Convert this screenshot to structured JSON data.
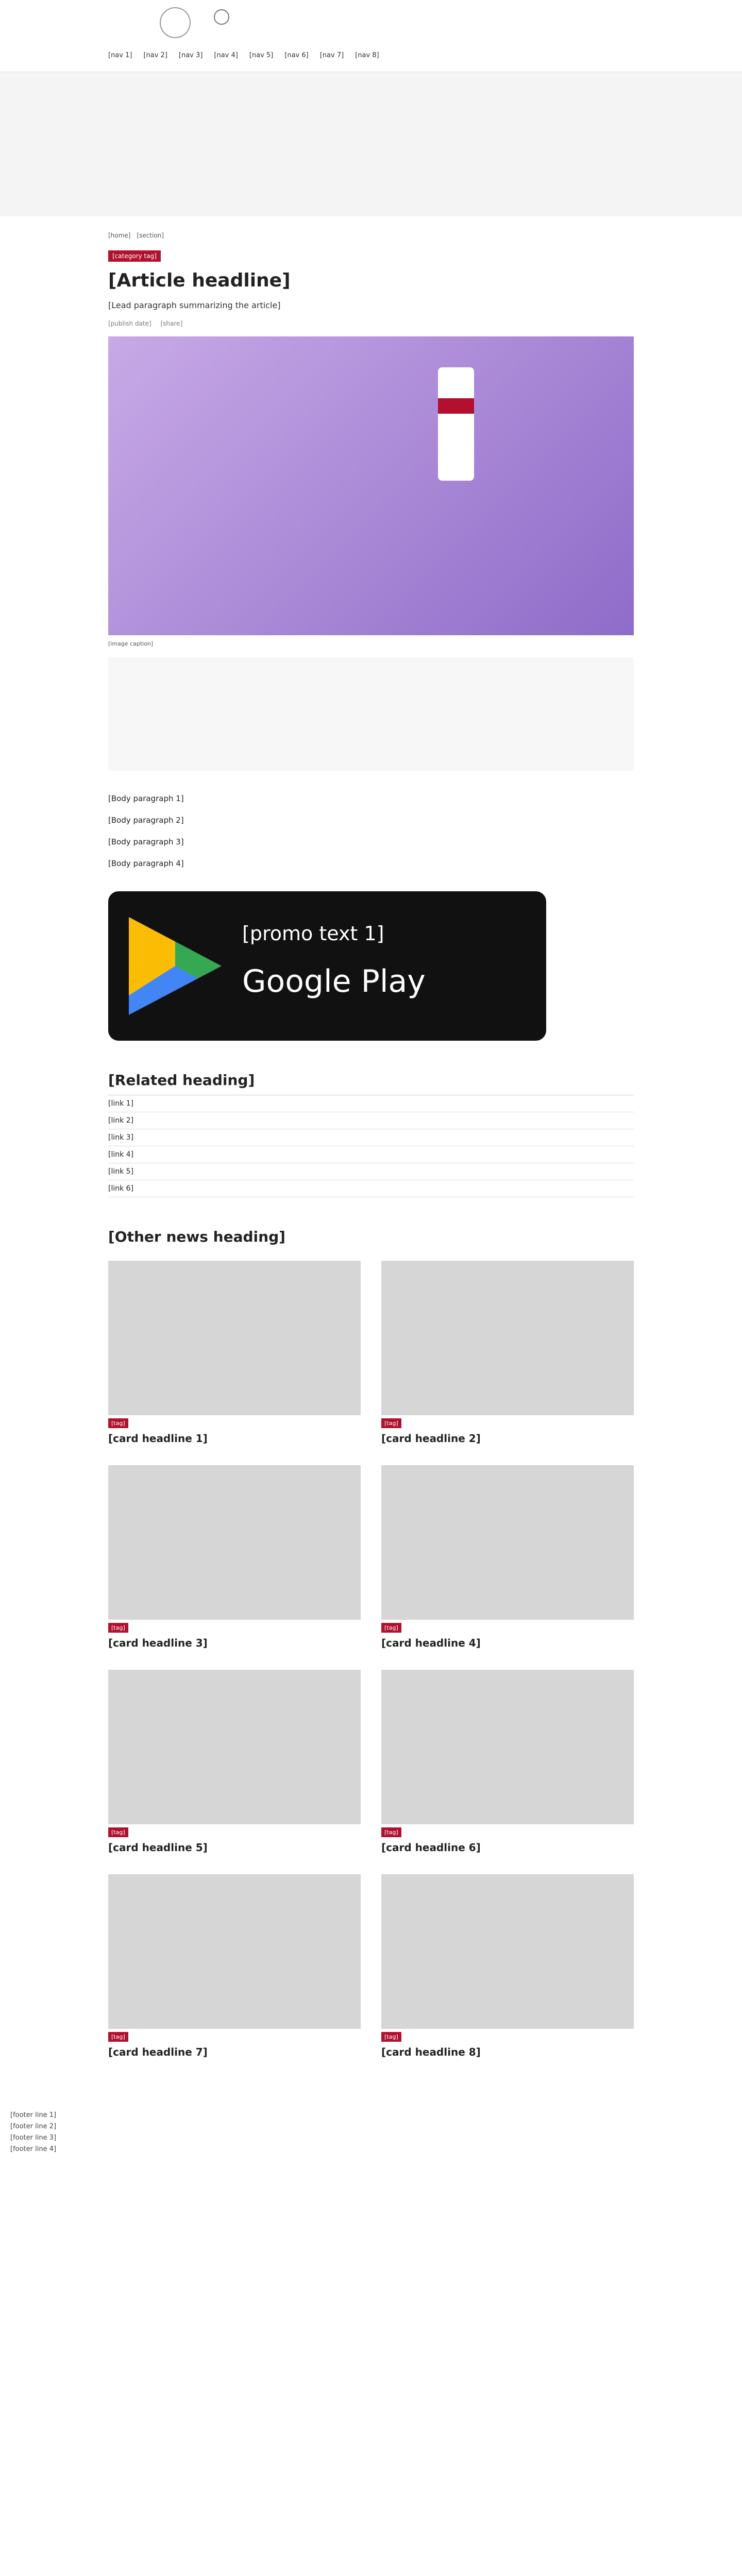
{
  "header": {
    "nav": [
      "[nav 1]",
      "[nav 2]",
      "[nav 3]",
      "[nav 4]",
      "[nav 5]",
      "[nav 6]",
      "[nav 7]",
      "[nav 8]"
    ]
  },
  "crumb": {
    "home": "[home]",
    "section": "[section]"
  },
  "article": {
    "tag": "[category tag]",
    "title": "[Article headline]",
    "lead": "[Lead paragraph summarizing the article]",
    "date": "[publish date]",
    "share": "[share]",
    "caption": "[image caption]",
    "paras": [
      "[Body paragraph 1]",
      "[Body paragraph 2]",
      "[Body paragraph 3]",
      "[Body paragraph 4]"
    ]
  },
  "promo": {
    "line1": "[promo text 1]",
    "line2": "Google Play"
  },
  "related": {
    "title": "[Related heading]",
    "items": [
      "[link 1]",
      "[link 2]",
      "[link 3]",
      "[link 4]",
      "[link 5]",
      "[link 6]"
    ]
  },
  "other": {
    "title": "[Other news heading]"
  },
  "cards": [
    {
      "tag": "[tag]",
      "title": "[card headline 1]"
    },
    {
      "tag": "[tag]",
      "title": "[card headline 2]"
    },
    {
      "tag": "[tag]",
      "title": "[card headline 3]"
    },
    {
      "tag": "[tag]",
      "title": "[card headline 4]"
    },
    {
      "tag": "[tag]",
      "title": "[card headline 5]"
    },
    {
      "tag": "[tag]",
      "title": "[card headline 6]"
    },
    {
      "tag": "[tag]",
      "title": "[card headline 7]"
    },
    {
      "tag": "[tag]",
      "title": "[card headline 8]"
    }
  ],
  "footer": {
    "lines": [
      "[footer line 1]",
      "[footer line 2]",
      "[footer line 3]",
      "[footer line 4]"
    ]
  }
}
